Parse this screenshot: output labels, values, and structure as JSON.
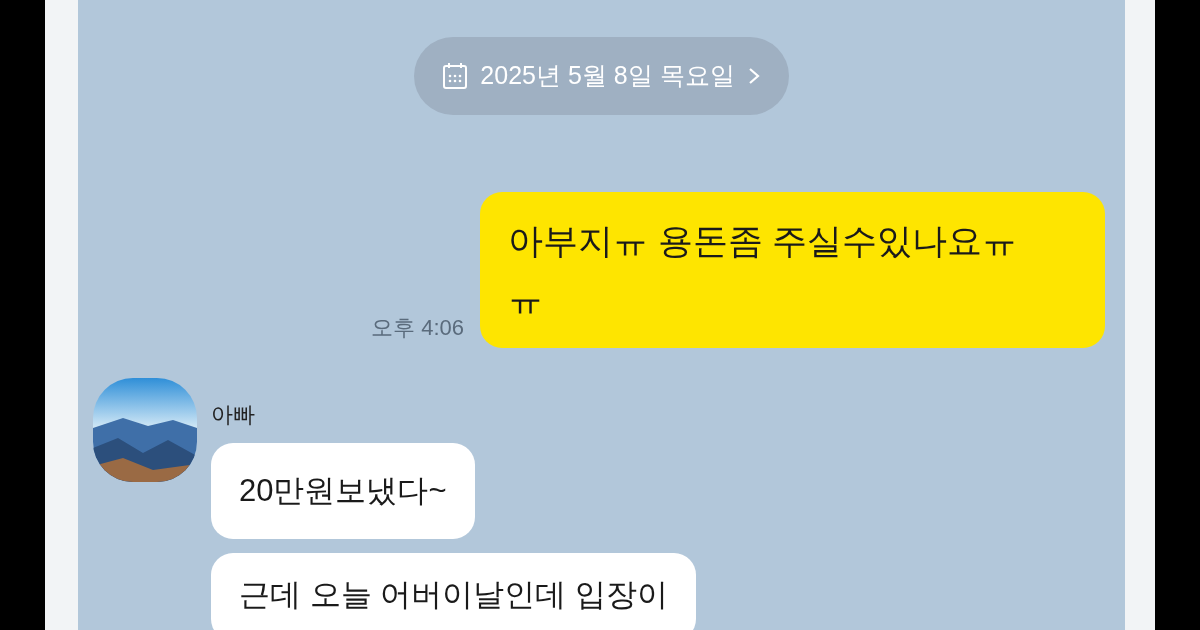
{
  "date_divider": {
    "text": "2025년 5월 8일 목요일"
  },
  "messages": [
    {
      "kind": "sent",
      "text": "아부지ㅠ 용돈좀 주실수있나요ㅠㅠ",
      "time": "오후 4:06"
    },
    {
      "kind": "received",
      "sender": "아빠",
      "texts": [
        "20만원보냈다~",
        "근데 오늘 어버이날인데 입장이"
      ]
    }
  ]
}
